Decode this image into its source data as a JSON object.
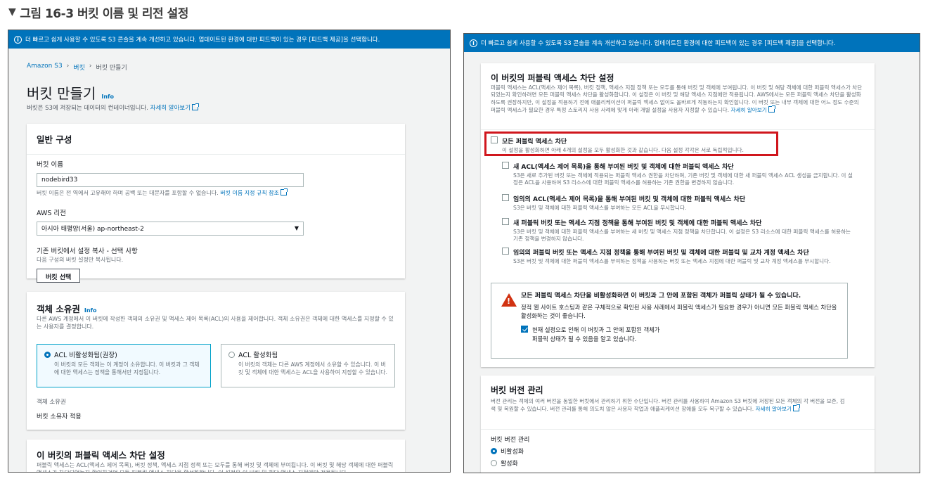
{
  "figure": {
    "caption": "그림 16-3 버킷 이름 및 리전 설정"
  },
  "banner": {
    "text": "더 빠르고 쉽게 사용할 수 있도록 S3 콘솔을 계속 개선하고 있습니다. 업데이트된 환경에 대한 피드백이 있는 경우 [피드백 제공]을 선택합니다."
  },
  "left": {
    "breadcrumb": [
      "Amazon S3",
      "버킷",
      "버킷 만들기"
    ],
    "page_title": "버킷 만들기",
    "info_label": "Info",
    "page_desc": "버킷은 S3에 저장되는 데이터의 컨테이너입니다.",
    "learn_more": "자세히 알아보기",
    "general": {
      "header": "일반 구성",
      "bucket_name_label": "버킷 이름",
      "bucket_name_value": "nodebird33",
      "bucket_name_hint": "버킷 이름은 전 역에서 고유해야 하며 공백 또는 대문자를 포함할 수 없습니다.",
      "bucket_name_rules": "버킷 이름 지정 규칙 참조",
      "region_label": "AWS 리전",
      "region_value": "아시아 태평양(서울) ap-northeast-2",
      "copy_label": "기존 버킷에서 설정 복사 - 선택 사항",
      "copy_hint": "다음 구성의 버킷 설정만 복사됩니다.",
      "choose_bucket_btn": "버킷 선택"
    },
    "ownership": {
      "header": "객체 소유권",
      "info_label": "Info",
      "desc": "다른 AWS 계정에서 이 버킷에 작성한 객체의 소유권 및 액세스 제어 목록(ACL)의 사용을 제어합니다. 객체 소유권은 객체에 대한 액세스를 지정할 수 있는 사용자를 결정합니다.",
      "tile1_title": "ACL 비활성화됨(권장)",
      "tile1_desc": "이 버킷의 모든 객체는 이 계정이 소유합니다. 이 버킷과 그 객체에 대한 액세스는 정책을 통해서만 지정됩니다.",
      "tile2_title": "ACL 활성화됨",
      "tile2_desc": "이 버킷의 객체는 다른 AWS 계정에서 소유할 수 있습니다. 이 버킷 및 객체에 대한 액세스는 ACL을 사용하여 지정할 수 있습니다.",
      "owner_label": "객체 소유권",
      "owner_value": "버킷 소유자 적용"
    },
    "bpa_header": "이 버킷의 퍼블릭 액세스 차단 설정",
    "bpa_desc_clip": "퍼블릭 액세스는 ACL(액세스 제어 목록), 버킷 정책, 액세스 지점 정책 또는 모두를 통해 버킷 및 객체에 부여됩니다. 이 버킷 및 해당 객체에 대한 퍼블릭 액세스가 차단되었는지 확인하려면 모든 퍼블릭 액세스 차단을 활성화합니다. 이 설정은 이 버킷 및 해당 액세스 지점에만 적용됩니다."
  },
  "right": {
    "bpa": {
      "header": "이 버킷의 퍼블릭 액세스 차단 설정",
      "desc": "퍼블릭 액세스는 ACL(액세스 제어 목록), 버킷 정책, 액세스 지점 정책 또는 모두를 통해 버킷 및 객체에 부여됩니다. 이 버킷 및 해당 객체에 대한 퍼블릭 액세스가 차단되었는지 확인하려면 모든 퍼블릭 액세스 차단을 활성화합니다. 이 설정은 이 버킷 및 해당 액세스 지점에만 적용됩니다. AWS에서는 모든 퍼블릭 액세스 차단을 활성화하도록 권장하지만, 이 설정을 적용하기 전에 애플리케이션이 퍼블릭 액세스 없이도 올바르게 작동하는지 확인합니다. 이 버킷 또는 내부 객체에 대한 어느 정도 수준의 퍼블릭 액세스가 필요한 경우 특정 스토리지 사용 사례에 맞게 아래 개별 설정을 사용자 지정할 수 있습니다.",
      "learn_more": "자세히 알아보기",
      "block_all_title": "모든 퍼블릭 액세스 차단",
      "block_all_desc": "이 설정을 활성화하면 아래 4개의 설정을 모두 활성화한 것과 같습니다. 다음 설정 각각은 서로 독립적입니다.",
      "items": [
        {
          "title": "새 ACL(액세스 제어 목록)을 통해 부여된 버킷 및 객체에 대한 퍼블릭 액세스 차단",
          "desc": "S3은 새로 추가된 버킷 또는 객체에 적용되는 퍼블릭 액세스 권한을 차단하며, 기존 버킷 및 객체에 대한 새 퍼블릭 액세스 ACL 생성을 금지합니다. 이 설정은 ACL을 사용하여 S3 리소스에 대한 퍼블릭 액세스를 허용하는 기존 권한을 변경하지 않습니다."
        },
        {
          "title": "임의의 ACL(액세스 제어 목록)을 통해 부여된 버킷 및 객체에 대한 퍼블릭 액세스 차단",
          "desc": "S3은 버킷 및 객체에 대한 퍼블릭 액세스를 부여하는 모든 ACL을 무시합니다."
        },
        {
          "title": "새 퍼블릭 버킷 또는 액세스 지점 정책을 통해 부여된 버킷 및 객체에 대한 퍼블릭 액세스 차단",
          "desc": "S3은 버킷 및 객체에 대한 퍼블릭 액세스를 부여하는 새 버킷 및 액세스 지점 정책을 차단합니다. 이 설정은 S3 리소스에 대한 퍼블릭 액세스를 허용하는 기존 정책을 변경하지 않습니다."
        },
        {
          "title": "임의의 퍼블릭 버킷 또는 액세스 지점 정책을 통해 부여된 버킷 및 객체에 대한 퍼블릭 및 교차 계정 액세스 차단",
          "desc": "S3은 버킷 및 객체에 대한 퍼블릭 액세스를 부여하는 정책을 사용하는 버킷 또는 액세스 지점에 대한 퍼블릭 및 교차 계정 액세스를 무시합니다."
        }
      ],
      "warning_title": "모든 퍼블릭 액세스 차단을 비활성화하면 이 버킷과 그 안에 포함된 객체가 퍼블릭 상태가 될 수 있습니다.",
      "warning_desc": "정적 웹 사이트 호스팅과 같은 구체적으로 확인된 사용 사례에서 퍼블릭 액세스가 필요한 경우가 아니면 모든 퍼블릭 액세스 차단을 활성화하는 것이 좋습니다.",
      "ack_text": "현재 설정으로 인해 이 버킷과 그 안에 포함된 객체가 퍼블릭 상태가 될 수 있음을 알고 있습니다."
    },
    "versioning": {
      "header": "버킷 버전 관리",
      "desc": "버전 관리는 객체의 여러 버전을 동일한 버킷에서 관리하기 위한 수단입니다. 버전 관리를 사용하여 Amazon S3 버킷에 저장된 모든 객체의 각 버전을 보존, 검색 및 복원할 수 있습니다. 버전 관리를 통해 의도치 않은 사용자 작업과 애플리케이션 장애를 모두 복구할 수 있습니다.",
      "learn_more": "자세히 알아보기",
      "label": "버킷 버전 관리",
      "option_off": "비활성화",
      "option_on": "활성화"
    }
  }
}
